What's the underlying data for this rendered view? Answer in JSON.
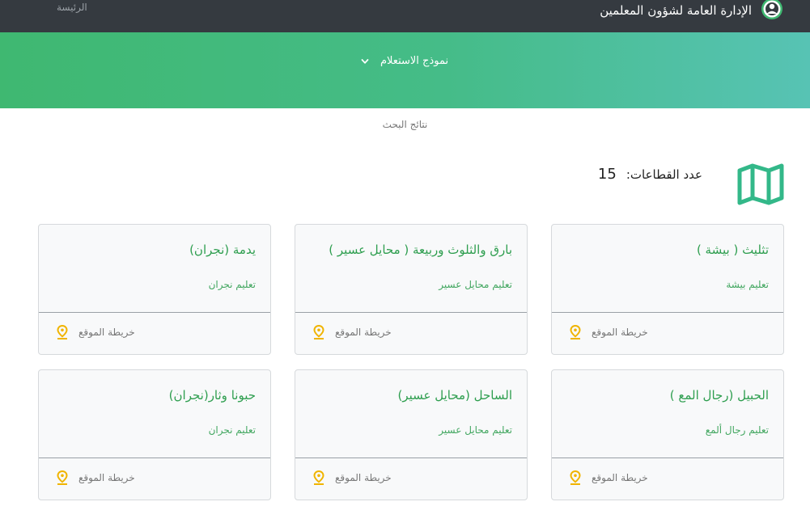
{
  "header": {
    "home": "الرئيسة",
    "title": "الإدارة العامة لشؤون المعلمين"
  },
  "hero": {
    "dropdown_label": "نموذج الاستعلام"
  },
  "results": {
    "label": "نتائج البحث",
    "count_label": "عدد القطاعات:",
    "count_value": "15"
  },
  "cards": [
    {
      "title": "يدمة (نجران)",
      "subtitle": "تعليم نجران",
      "link": "خريطة الموقع"
    },
    {
      "title": "بارق والثلوث وربيعة ( محايل عسير )",
      "subtitle": "تعليم محايل عسير",
      "link": "خريطة الموقع"
    },
    {
      "title": "تثليث ( بيشة )",
      "subtitle": "تعليم بيشة",
      "link": "خريطة الموقع"
    },
    {
      "title": "حبونا وثار(نجران)",
      "subtitle": "تعليم نجران",
      "link": "خريطة الموقع"
    },
    {
      "title": "الساحل (محايل عسير)",
      "subtitle": "تعليم محايل عسير",
      "link": "خريطة الموقع"
    },
    {
      "title": "الحبيل (رجال المع )",
      "subtitle": "تعليم رجال ألمع",
      "link": "خريطة الموقع"
    }
  ],
  "colors": {
    "topbar": "#353a40",
    "accent_green": "#2e9e4f",
    "hero_start": "#3fb871",
    "hero_end": "#57c3b4",
    "pin": "#f0b400",
    "map_icon": "#33b889"
  },
  "icons": {
    "logo": "circle-logo-icon",
    "dropdown": "chevron-down-icon",
    "sectors": "folded-map-icon",
    "location": "map-pin-icon"
  }
}
